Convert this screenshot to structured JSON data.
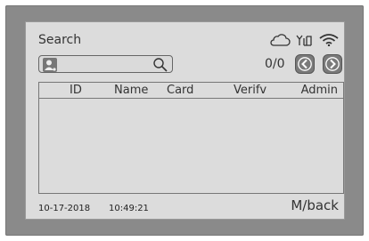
{
  "header": {
    "title": "Search",
    "status_icons": [
      "cloud-icon",
      "antenna-icon",
      "wifi-icon"
    ]
  },
  "search": {
    "value": "",
    "placeholder": "",
    "icon": "user-icon",
    "action_icon": "search-icon"
  },
  "pager": {
    "count": "0/0",
    "prev_icon": "chevron-left-icon",
    "next_icon": "chevron-right-icon"
  },
  "table": {
    "columns": [
      "ID",
      "Name",
      "Card",
      "Verifv",
      "Admin"
    ],
    "rows": []
  },
  "footer": {
    "date": "10-17-2018",
    "time": "10:49:21",
    "back_label": "M/back"
  },
  "colors": {
    "bezel": "#8a8a8a",
    "screen": "#dcdcdc",
    "button": "#7a7a7a"
  }
}
